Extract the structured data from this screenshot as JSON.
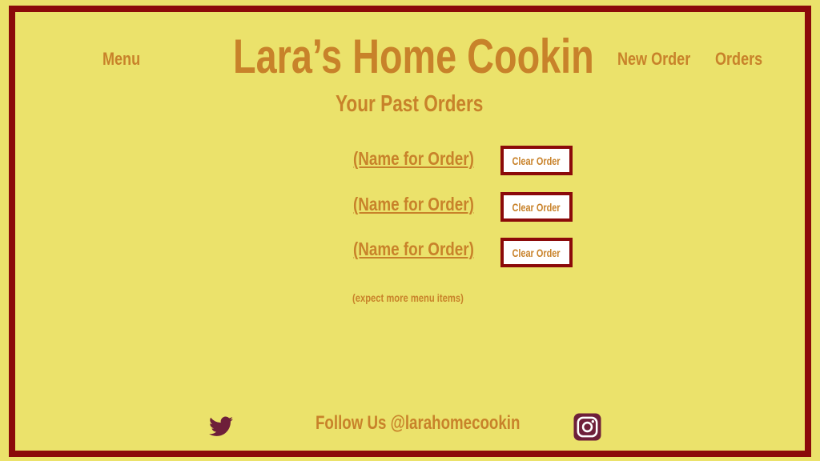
{
  "nav": {
    "menu_label": "Menu",
    "new_order_label": "New Order",
    "orders_label": "Orders"
  },
  "header": {
    "site_title": "Lara’s Home Cookin"
  },
  "main": {
    "page_title": "Your Past Orders",
    "orders": [
      {
        "name": "(Name for Order)",
        "clear_label": "Clear Order"
      },
      {
        "name": "(Name for Order)",
        "clear_label": "Clear Order"
      },
      {
        "name": "(Name for Order)",
        "clear_label": "Clear Order"
      }
    ],
    "note": "(expect more menu items)"
  },
  "footer": {
    "follow_text": "Follow Us @larahomecookin",
    "twitter_icon": "twitter-icon",
    "instagram_icon": "instagram-icon"
  },
  "colors": {
    "background": "#ebe26b",
    "border": "#8b0a0a",
    "text": "#c8822a",
    "icon": "#6e1f3a"
  }
}
